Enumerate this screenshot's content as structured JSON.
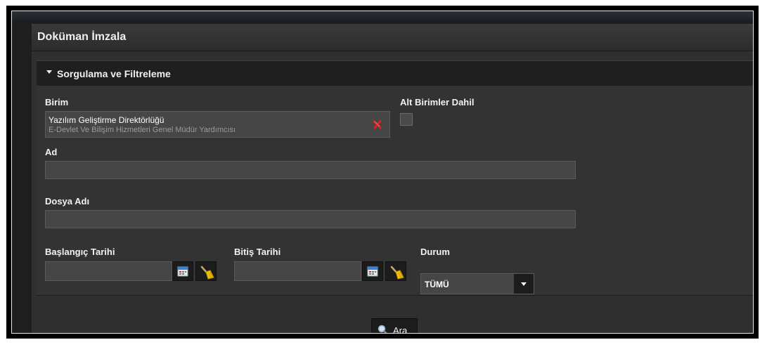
{
  "page": {
    "title": "Doküman İmzala"
  },
  "filter": {
    "section_title": "Sorgulama ve Filtreleme",
    "unit": {
      "label": "Birim",
      "value": "Yazılım Geliştirme Direktörlüğü",
      "subtitle": "E-Devlet Ve Bilişim Hizmetleri Genel Müdür Yardımcısı"
    },
    "include_subunits": {
      "label": "Alt Birimler Dahil",
      "checked": false
    },
    "name": {
      "label": "Ad",
      "value": ""
    },
    "file_name": {
      "label": "Dosya Adı",
      "value": ""
    },
    "start_date": {
      "label": "Başlangıç Tarihi",
      "value": ""
    },
    "end_date": {
      "label": "Bitiş Tarihi",
      "value": ""
    },
    "status": {
      "label": "Durum",
      "value": "TÜMÜ"
    }
  },
  "actions": {
    "search_label": "Ara"
  },
  "icons": {
    "calendar": "calendar-icon",
    "broom": "broom-icon",
    "clear": "clear-x-icon",
    "search": "magnifier-icon",
    "dropdown": "chevron-down-icon"
  },
  "colors": {
    "background": "#2f2f2f",
    "header": "#1f1f1f",
    "input": "#464646",
    "accent_red": "#e02020"
  }
}
